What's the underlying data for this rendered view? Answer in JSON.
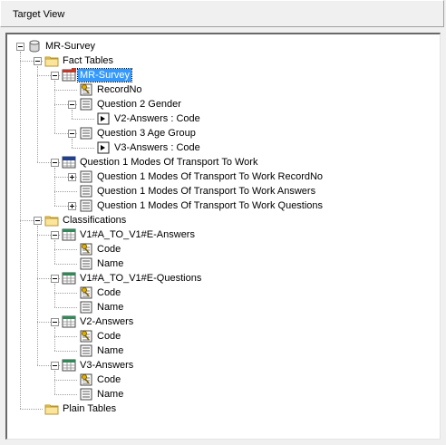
{
  "panel": {
    "title": "Target View"
  },
  "tree": [
    {
      "id": "n0",
      "label": "MR-Survey",
      "icon": "database-icon",
      "level": 0,
      "expander": "minus"
    },
    {
      "id": "n1",
      "label": "Fact Tables",
      "icon": "folder-icon",
      "level": 1,
      "expander": "minus"
    },
    {
      "id": "n2",
      "label": "MR-Survey",
      "icon": "fact-table-icon",
      "level": 2,
      "expander": "minus",
      "selected": true
    },
    {
      "id": "n3",
      "label": "RecordNo",
      "icon": "key-field-icon",
      "level": 3,
      "expander": "none"
    },
    {
      "id": "n4",
      "label": "Question 2 Gender",
      "icon": "field-icon",
      "level": 3,
      "expander": "minus"
    },
    {
      "id": "n5",
      "label": "V2-Answers : Code",
      "icon": "link-icon",
      "level": 4,
      "expander": "none"
    },
    {
      "id": "n6",
      "label": "Question 3 Age Group",
      "icon": "field-icon",
      "level": 3,
      "expander": "minus"
    },
    {
      "id": "n7",
      "label": "V3-Answers : Code",
      "icon": "link-icon",
      "level": 4,
      "expander": "none"
    },
    {
      "id": "n8",
      "label": "Question 1 Modes Of Transport To Work",
      "icon": "table-blue-icon",
      "level": 2,
      "expander": "minus"
    },
    {
      "id": "n9",
      "label": "Question 1 Modes Of Transport To Work RecordNo",
      "icon": "field-icon",
      "level": 3,
      "expander": "plus"
    },
    {
      "id": "n10",
      "label": "Question 1 Modes Of Transport To Work Answers",
      "icon": "field-icon",
      "level": 3,
      "expander": "none"
    },
    {
      "id": "n11",
      "label": "Question 1 Modes Of Transport To Work Questions",
      "icon": "field-icon",
      "level": 3,
      "expander": "plus"
    },
    {
      "id": "n12",
      "label": "Classifications",
      "icon": "folder-icon",
      "level": 1,
      "expander": "minus"
    },
    {
      "id": "n13",
      "label": "V1#A_TO_V1#E-Answers",
      "icon": "table-green-icon",
      "level": 2,
      "expander": "minus"
    },
    {
      "id": "n14",
      "label": "Code",
      "icon": "key-field-icon",
      "level": 3,
      "expander": "none"
    },
    {
      "id": "n15",
      "label": "Name",
      "icon": "field-icon",
      "level": 3,
      "expander": "none"
    },
    {
      "id": "n16",
      "label": "V1#A_TO_V1#E-Questions",
      "icon": "table-green-icon",
      "level": 2,
      "expander": "minus"
    },
    {
      "id": "n17",
      "label": "Code",
      "icon": "key-field-icon",
      "level": 3,
      "expander": "none"
    },
    {
      "id": "n18",
      "label": "Name",
      "icon": "field-icon",
      "level": 3,
      "expander": "none"
    },
    {
      "id": "n19",
      "label": "V2-Answers",
      "icon": "table-green-icon",
      "level": 2,
      "expander": "minus"
    },
    {
      "id": "n20",
      "label": "Code",
      "icon": "key-field-icon",
      "level": 3,
      "expander": "none"
    },
    {
      "id": "n21",
      "label": "Name",
      "icon": "field-icon",
      "level": 3,
      "expander": "none"
    },
    {
      "id": "n22",
      "label": "V3-Answers",
      "icon": "table-green-icon",
      "level": 2,
      "expander": "minus"
    },
    {
      "id": "n23",
      "label": "Code",
      "icon": "key-field-icon",
      "level": 3,
      "expander": "none"
    },
    {
      "id": "n24",
      "label": "Name",
      "icon": "field-icon",
      "level": 3,
      "expander": "none"
    },
    {
      "id": "n25",
      "label": "Plain Tables",
      "icon": "folder-icon",
      "level": 1,
      "expander": "none"
    }
  ],
  "colors": {
    "selection": "#3399ff",
    "folder": "#f5d66b",
    "fact_table_header": "#c0392b",
    "table_header_green": "#2e8b57",
    "table_header_blue": "#1f3f8f"
  }
}
